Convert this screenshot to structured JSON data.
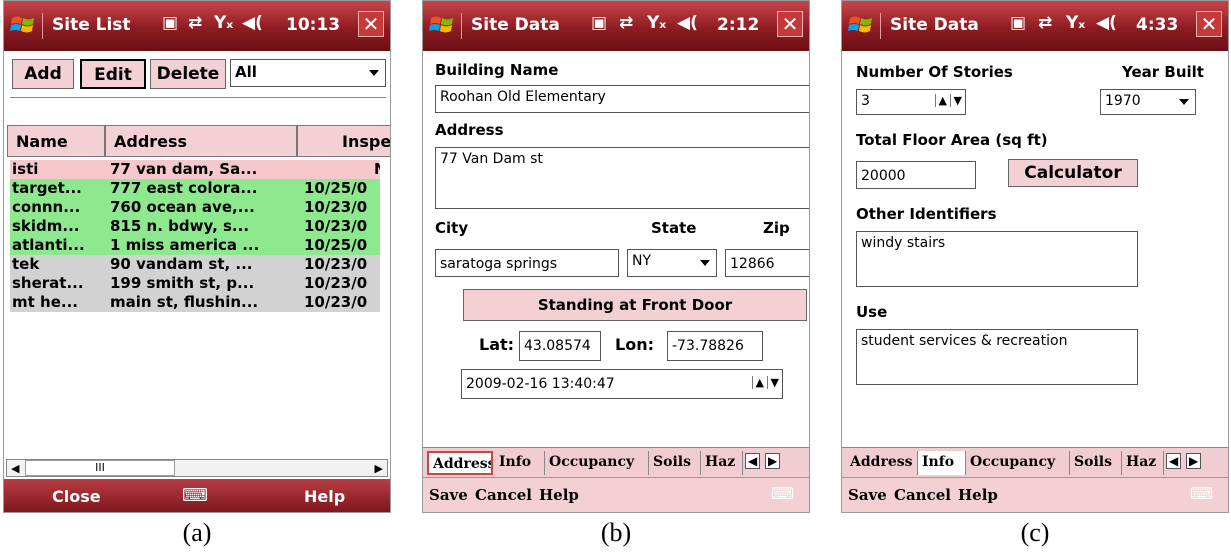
{
  "panel_a": {
    "title": "Site List",
    "time": "10:13",
    "buttons": {
      "add": "Add",
      "edit": "Edit",
      "delete": "Delete"
    },
    "filter_value": "All",
    "columns": [
      "Name",
      "Address",
      "Inspe"
    ],
    "rows": [
      {
        "name": "isti",
        "address": "77 van dam, Sa...",
        "date": "N"
      },
      {
        "name": "target...",
        "address": "777 east colora...",
        "date": "10/25/0"
      },
      {
        "name": "connn...",
        "address": "760 ocean ave,...",
        "date": "10/23/0"
      },
      {
        "name": "skidm...",
        "address": "815 n. bdwy, s...",
        "date": "10/23/0"
      },
      {
        "name": "atlanti...",
        "address": "1 miss america ...",
        "date": "10/25/0"
      },
      {
        "name": "tek",
        "address": "90 vandam st, ...",
        "date": "10/23/0"
      },
      {
        "name": "sherat...",
        "address": "199 smith st, p...",
        "date": "10/23/0"
      },
      {
        "name": "mt he...",
        "address": "main st, flushin...",
        "date": "10/23/0"
      }
    ],
    "row_colors": [
      "#f6c7cd",
      "#8ee88e",
      "#8ee88e",
      "#8ee88e",
      "#8ee88e",
      "#d2d2d2",
      "#d2d2d2",
      "#d2d2d2"
    ],
    "scrollbar_grip": "III",
    "softkeys": {
      "left": "Close",
      "right": "Help"
    },
    "caption": "(a)"
  },
  "panel_b": {
    "title": "Site Data",
    "time": "2:12",
    "building_name_label": "Building Name",
    "building_name": "Roohan Old Elementary",
    "address_label": "Address",
    "address": "77 Van Dam st",
    "city_label": "City",
    "city": "saratoga springs",
    "state_label": "State",
    "state": "NY",
    "zip_label": "Zip",
    "zip": "12866",
    "standing_button": "Standing at Front Door",
    "lat_label": "Lat:",
    "lat": "43.08574",
    "lon_label": "Lon:",
    "lon": "-73.78826",
    "datetime": "2009-02-16 13:40:47",
    "tabs": [
      "Address",
      "Info",
      "Occupancy",
      "Soils",
      "Haz"
    ],
    "menu": {
      "save": "Save",
      "cancel": "Cancel",
      "help": "Help"
    },
    "caption": "(b)"
  },
  "panel_c": {
    "title": "Site Data",
    "time": "4:33",
    "stories_label": "Number Of Stories",
    "stories": "3",
    "year_label": "Year Built",
    "year": "1970",
    "area_label": "Total Floor Area (sq ft)",
    "area": "20000",
    "calculator_button": "Calculator",
    "other_label": "Other Identifiers",
    "other": "windy stairs",
    "use_label": "Use",
    "use": "student services  & recreation",
    "tabs": [
      "Address",
      "Info",
      "Occupancy",
      "Soils",
      "Haz"
    ],
    "menu": {
      "save": "Save",
      "cancel": "Cancel",
      "help": "Help"
    },
    "caption": "(c)"
  },
  "status_icons": {
    "connectivity": "⇄",
    "signal": "Yₓ",
    "volume": "◀("
  },
  "accent_colors": {
    "title_bar": "#9b1f27",
    "pink": "#f2d0d4",
    "green_row": "#8ee88e",
    "grey_row": "#d2d2d2"
  }
}
